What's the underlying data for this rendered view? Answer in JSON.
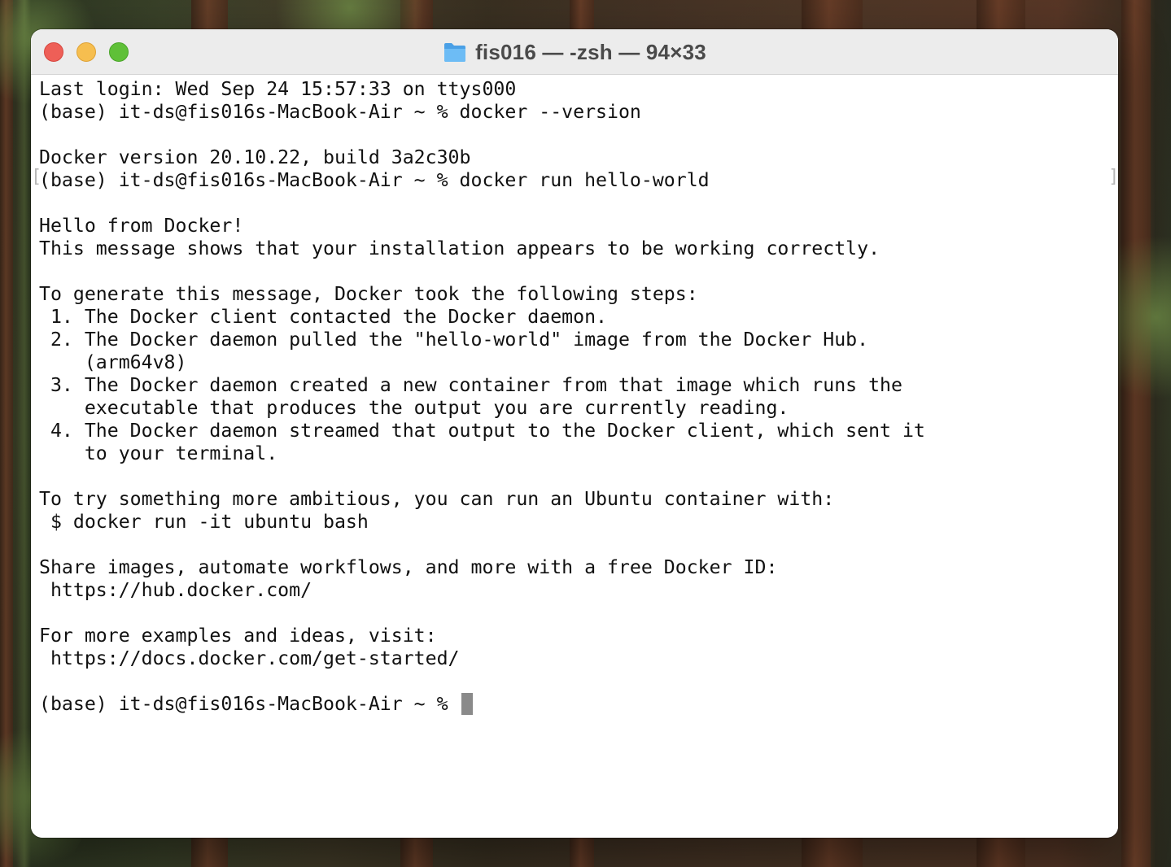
{
  "window": {
    "title": "fis016 — -zsh — 94×33",
    "title_icon": "folder-icon",
    "controls": [
      "close",
      "minimize",
      "zoom"
    ]
  },
  "colors": {
    "close": "#ee5f57",
    "minimize": "#f6be4f",
    "zoom": "#5fc038",
    "folder": "#5aaef0",
    "cursor": "#8a8a8a"
  },
  "terminal": {
    "lines": [
      "Last login: Wed Sep 24 15:57:33 on ttys000",
      "(base) it-ds@fis016s-MacBook-Air ~ % docker --version",
      "",
      "Docker version 20.10.22, build 3a2c30b",
      "(base) it-ds@fis016s-MacBook-Air ~ % docker run hello-world",
      "",
      "Hello from Docker!",
      "This message shows that your installation appears to be working correctly.",
      "",
      "To generate this message, Docker took the following steps:",
      " 1. The Docker client contacted the Docker daemon.",
      " 2. The Docker daemon pulled the \"hello-world\" image from the Docker Hub.",
      "    (arm64v8)",
      " 3. The Docker daemon created a new container from that image which runs the",
      "    executable that produces the output you are currently reading.",
      " 4. The Docker daemon streamed that output to the Docker client, which sent it",
      "    to your terminal.",
      "",
      "To try something more ambitious, you can run an Ubuntu container with:",
      " $ docker run -it ubuntu bash",
      "",
      "Share images, automate workflows, and more with a free Docker ID:",
      " https://hub.docker.com/",
      "",
      "For more examples and ideas, visit:",
      " https://docs.docker.com/get-started/",
      ""
    ],
    "prompt": "(base) it-ds@fis016s-MacBook-Air ~ % "
  }
}
